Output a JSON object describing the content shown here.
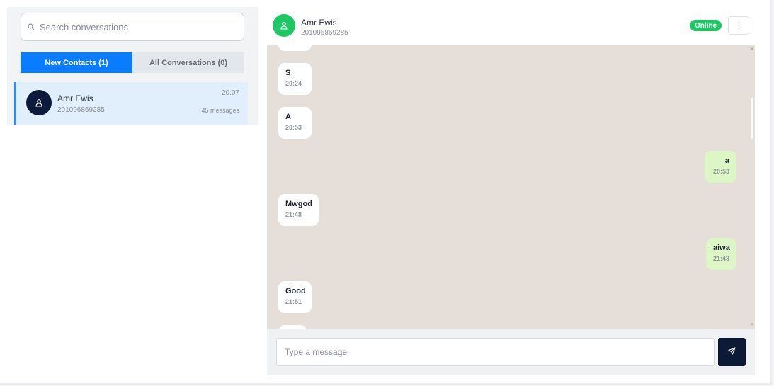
{
  "sidebar": {
    "search": {
      "placeholder": "Search conversations",
      "icon": "search-icon"
    },
    "tabs": [
      {
        "label": "New Contacts (1)",
        "active": true
      },
      {
        "label": "All Conversations (0)",
        "active": false
      }
    ],
    "contacts": [
      {
        "name": "Amr Ewis",
        "phone": "201096869285",
        "time": "20:07",
        "message_count": "45 messages",
        "avatar_icon": "user-icon"
      }
    ]
  },
  "chat": {
    "header": {
      "name": "Amr Ewis",
      "phone": "201096869285",
      "status": "Online",
      "avatar_icon": "user-icon"
    },
    "messages": [
      {
        "direction": "in",
        "text": "S",
        "time": "20:24"
      },
      {
        "direction": "in",
        "text": "A",
        "time": "20:53"
      },
      {
        "direction": "out",
        "text": "a",
        "time": "20:53"
      },
      {
        "direction": "in",
        "text": "Mwgod",
        "time": "21:48"
      },
      {
        "direction": "out",
        "text": "aiwa",
        "time": "21:48"
      },
      {
        "direction": "in",
        "text": "Good",
        "time": "21:51"
      }
    ],
    "composer": {
      "placeholder": "Type a message",
      "send_icon": "send-icon"
    }
  },
  "colors": {
    "accent": "#0a7cff",
    "online": "#1fc765",
    "dark_avatar": "#0d1b3a",
    "chat_bg": "#e6dfd9",
    "outgoing_bubble": "#dcf7c5"
  }
}
